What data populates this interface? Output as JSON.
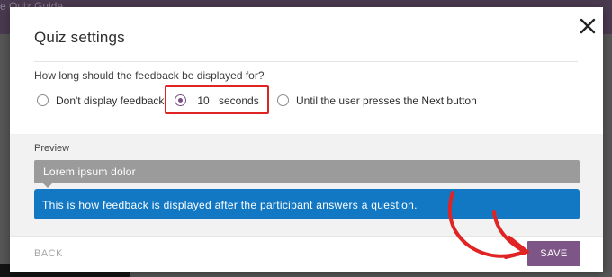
{
  "background": {
    "peek_title": "e Quiz Guide"
  },
  "modal": {
    "title": "Quiz settings",
    "close_icon": "close-icon",
    "question": "How long should the feedback be displayed for?",
    "options": [
      {
        "label": "Don't display feedback",
        "checked": false
      },
      {
        "prefix_value": "10",
        "label": "seconds",
        "checked": true
      },
      {
        "label": "Until the user presses the Next button",
        "checked": false
      }
    ],
    "preview": {
      "label": "Preview",
      "question_text": "Lorem ipsum dolor",
      "feedback_text": "This is how feedback is displayed after the participant answers a question."
    },
    "footer": {
      "back_label": "BACK",
      "save_label": "SAVE"
    }
  },
  "colors": {
    "accent": "#7d5586",
    "feedback_bg": "#1378c4",
    "question_bg": "#9b9b9b",
    "highlight": "#e02424"
  }
}
